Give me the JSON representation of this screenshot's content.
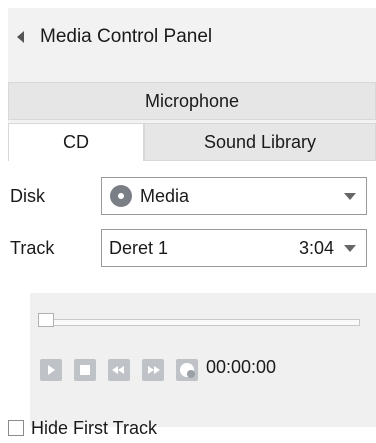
{
  "panel": {
    "title": "Media Control Panel"
  },
  "tabs_top": [
    {
      "label": "Microphone"
    }
  ],
  "tabs_bottom": [
    {
      "label": "CD",
      "active": true
    },
    {
      "label": "Sound Library",
      "active": false
    }
  ],
  "disk": {
    "label": "Disk",
    "value": "Media",
    "icon": "disc-icon"
  },
  "track": {
    "label": "Track",
    "name": "Deret 1",
    "duration": "3:04"
  },
  "player": {
    "progress": 0,
    "timecode": "00:00:00",
    "controls": [
      "play-icon",
      "stop-icon",
      "rewind-icon",
      "fast-forward-icon",
      "record-icon"
    ]
  },
  "options": {
    "hide_first_track_label": "Hide First Track",
    "hide_first_track_checked": false
  },
  "colors": {
    "panel_bg": "#f2f2f2",
    "control_gray": "#bfc3c8"
  }
}
